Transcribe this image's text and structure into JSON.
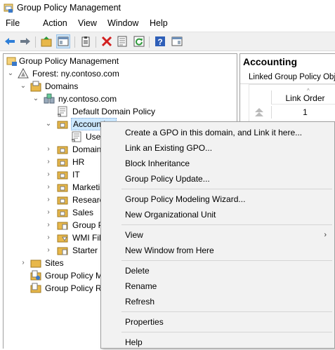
{
  "window": {
    "title": "Group Policy Management",
    "app_icon": "gpm-icon"
  },
  "menubar": [
    "File",
    "Action",
    "View",
    "Window",
    "Help"
  ],
  "toolbar": {
    "buttons": [
      "back-arrow-icon",
      "forward-arrow-icon",
      "up-folder-icon",
      "show-hide-tree-icon",
      "clipboard-icon",
      "delete-icon",
      "properties-icon",
      "refresh-icon",
      "help-icon",
      "console-icon"
    ]
  },
  "tree": {
    "root": "Group Policy Management",
    "forest": "Forest: ny.contoso.com",
    "domains": "Domains",
    "domain": "ny.contoso.com",
    "default_policy": "Default Domain Policy",
    "accounting": "Accounting",
    "accounting_child": "Use",
    "domain_controllers": "Domain",
    "hr": "HR",
    "it": "IT",
    "marketing": "Marketi",
    "research": "Researc",
    "sales": "Sales",
    "group_policy_objects": "Group P",
    "wmi_filters": "WMI Fil",
    "starter_gpos": "Starter (",
    "sites": "Sites",
    "modeling": "Group Policy M",
    "results": "Group Policy R"
  },
  "right_pane": {
    "title": "Accounting",
    "tab": "Linked Group Policy Objec",
    "column_header": "Link Order",
    "cell_value": "1"
  },
  "context_menu": {
    "items": [
      {
        "label": "Create a GPO in this domain, and Link it here...",
        "group": 1
      },
      {
        "label": "Link an Existing GPO...",
        "group": 1
      },
      {
        "label": "Block Inheritance",
        "group": 1
      },
      {
        "label": "Group Policy Update...",
        "group": 1
      },
      {
        "label": "Group Policy Modeling Wizard...",
        "group": 2
      },
      {
        "label": "New Organizational Unit",
        "group": 2
      },
      {
        "label": "View",
        "group": 3,
        "submenu": true
      },
      {
        "label": "New Window from Here",
        "group": 3
      },
      {
        "label": "Delete",
        "group": 4
      },
      {
        "label": "Rename",
        "group": 4
      },
      {
        "label": "Refresh",
        "group": 4
      },
      {
        "label": "Properties",
        "group": 5
      },
      {
        "label": "Help",
        "group": 6
      }
    ]
  },
  "colors": {
    "selection": "#cce8ff",
    "menu_bg": "#f2f2f2",
    "toolbar_bg": "#f0f0f0",
    "folder": "#e8b84a"
  }
}
